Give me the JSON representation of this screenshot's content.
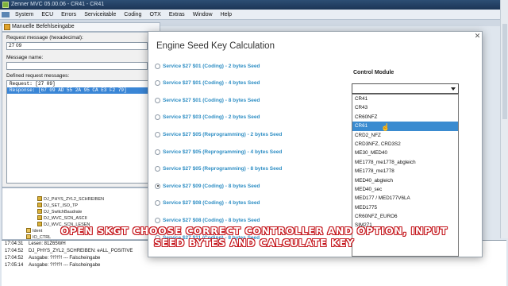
{
  "app": {
    "title": "Zenner MVC 05.00.06 - CR41 - CR41",
    "menu": [
      "System",
      "ECU",
      "Errors",
      "Serviceitable",
      "Coding",
      "OTX",
      "Extras",
      "Window",
      "Help"
    ]
  },
  "subwindow": {
    "title": "Manuelle Befehlseingabe",
    "request_label": "Request message (hexadecimal):",
    "request_value": "27 09",
    "name_label": "Message name:",
    "name_value": "",
    "defined_label": "Defined request messages:",
    "defined_rows": [
      "Request:      [27 09]",
      "  Response:  [67 09 AD 55 2A 95 CA E3 F2 79]"
    ]
  },
  "tree": [
    "DJ_PHYS_ZYL2_SCHREIBEN",
    "DJ_SET_ISO_TP",
    "DJ_SwitchBaudrate",
    "DJ_WVC_SCN_ASCII",
    "DJ_WVC_SCN_LESEN",
    "Ident",
    "IO_CTRL"
  ],
  "log": [
    {
      "time": "17:04:31",
      "text": "Lesen: 81Z65WH"
    },
    {
      "time": "17:04:52",
      "text": "DJ_PHYS_ZYL2_SCHREIBEN: eALL_POSITIVE"
    },
    {
      "time": "17:04:52",
      "text": "Ausgabe:  ?!?!?!  ---  Falscheingabe"
    },
    {
      "time": "17:05:14",
      "text": "Ausgabe:  ?!?!?!  ---  Falscheingabe"
    }
  ],
  "modal": {
    "title": "Engine Seed Key Calculation",
    "close": "✕",
    "options": [
      {
        "label": "Service $27 $01 (Coding) - 2 bytes Seed",
        "checked": false
      },
      {
        "label": "Service $27 $01 (Coding) - 4 bytes Seed",
        "checked": false
      },
      {
        "label": "Service $27 $01 (Coding) - 8 bytes Seed",
        "checked": false
      },
      {
        "label": "Service $27 $03 (Coding) - 2 bytes Seed",
        "checked": false
      },
      {
        "label": "Service $27 $05 (Reprogramming) - 2 bytes Seed",
        "checked": false
      },
      {
        "label": "Service $27 $05 (Reprogramming) - 4 bytes Seed",
        "checked": false
      },
      {
        "label": "Service $27 $05 (Reprogramming) - 8 bytes Seed",
        "checked": false
      },
      {
        "label": "Service $27 $09 (Coding) - 8 bytes Seed",
        "checked": true
      },
      {
        "label": "Service $27 $08 (Coding) - 4 bytes Seed",
        "checked": false
      },
      {
        "label": "Service $27 $08 (Coding) - 8 bytes Seed",
        "checked": false
      },
      {
        "label": "Service $27 $11 (Coding) - 8 bytes Seed",
        "checked": false
      }
    ],
    "control_module_label": "Control Module",
    "control_module_value": "",
    "control_module_options": [
      "CR41",
      "CR43",
      "CR60NFZ",
      "CR61",
      "CRD2_NFZ",
      "CRD3NFZ, CRD3S2",
      "ME30_MED40",
      "ME1778_me1778_abgleich",
      "ME1778_me1778",
      "MED40_abgleich",
      "MED40_sec",
      "MED177 / MED177V6LA",
      "MED1775",
      "CR60NFZ_EURO6",
      "SIM271"
    ],
    "control_module_highlighted": "CR61"
  },
  "caption": {
    "line1": "OPEN SKGT CHOOSE CORRECT CONTROLLER AND OPTION, INPUT",
    "line2": "SEED BYTES AND CALCULATE KEY"
  }
}
